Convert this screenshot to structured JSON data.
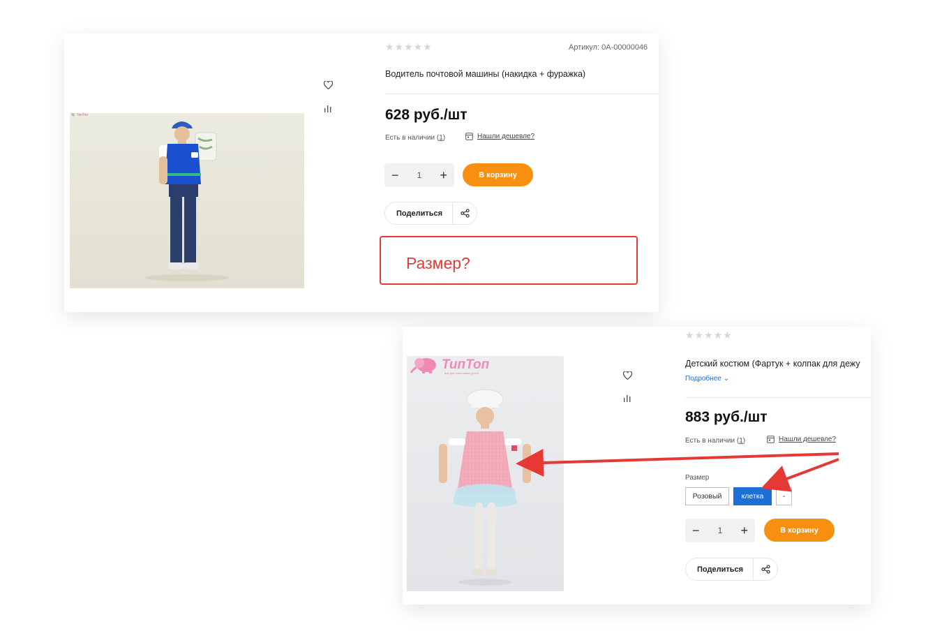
{
  "card1": {
    "stars": "★★★★★",
    "article": "Артикул: 0А-00000046",
    "title": "Водитель почтовой машины (накидка + фуражка)",
    "price": "628 руб./шт",
    "stock_prefix": "Есть в наличии (",
    "stock_count": "1",
    "stock_suffix": ")",
    "cheaper": "Нашли дешевле?",
    "qty": {
      "minus": "−",
      "value": "1",
      "plus": "+"
    },
    "buy_label": "В корзину",
    "share_label": "Поделиться",
    "photo_logo": "🐘 ТипТоп"
  },
  "annotation": {
    "text": "Размер?"
  },
  "card2": {
    "stars": "★★★★★",
    "title": "Детский костюм (Фартук + колпак для дежу",
    "more": "Подробнее ⌄",
    "price": "883 руб./шт",
    "stock_prefix": "Есть в наличии (",
    "stock_count": "1",
    "stock_suffix": ")",
    "cheaper": "Нашли дешевле?",
    "size_label": "Размер",
    "size_options": [
      "Розовый",
      "клетка",
      "-"
    ],
    "qty": {
      "minus": "−",
      "value": "1",
      "plus": "+"
    },
    "buy_label": "В корзину",
    "share_label": "Поделиться",
    "logo_brand": "ТипТоп",
    "logo_tag": "всё для счастливых детей"
  },
  "colors": {
    "accent_orange": "#f79010",
    "accent_blue": "#1b6fd6",
    "annotation_red": "#e53935"
  },
  "icons": [
    "heart-icon",
    "compare-icon",
    "share-icon",
    "cheaper-icon",
    "elephant-logo-icon"
  ]
}
